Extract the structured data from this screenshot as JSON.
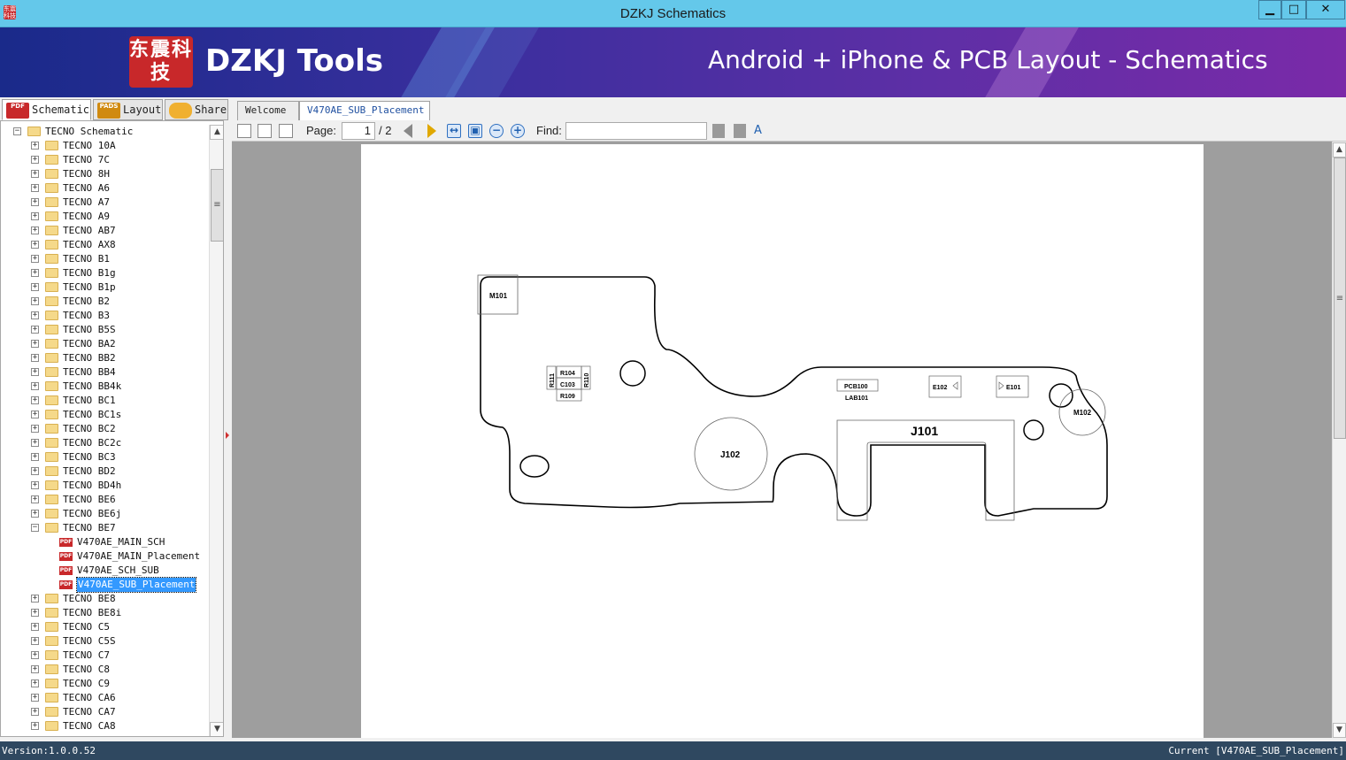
{
  "window": {
    "title": "DZKJ Schematics",
    "app_icon_text": "东震科技",
    "min_glyph": "▁",
    "max_glyph": "□",
    "close_glyph": "✕"
  },
  "banner": {
    "logo_text": "东震科技",
    "brand": "DZKJ Tools",
    "tagline": "Android + iPhone & PCB Layout - Schematics"
  },
  "left_tabs": [
    {
      "label": "Schematic",
      "icon": "pdf-icon",
      "icon_text": "PDF"
    },
    {
      "label": "Layout",
      "icon": "pads-icon",
      "icon_text": "PADS"
    },
    {
      "label": "Share",
      "icon": "share-icon",
      "icon_text": ""
    }
  ],
  "doc_tabs": [
    {
      "label": "Welcome"
    },
    {
      "label": "V470AE_SUB_Placement"
    }
  ],
  "tree": {
    "root": "TECNO Schematic",
    "folders_before": [
      "TECNO 10A",
      "TECNO 7C",
      "TECNO 8H",
      "TECNO A6",
      "TECNO A7",
      "TECNO A9",
      "TECNO AB7",
      "TECNO AX8",
      "TECNO B1",
      "TECNO B1g",
      "TECNO B1p",
      "TECNO B2",
      "TECNO B3",
      "TECNO B5S",
      "TECNO BA2",
      "TECNO BB2",
      "TECNO BB4",
      "TECNO BB4k",
      "TECNO BC1",
      "TECNO BC1s",
      "TECNO BC2",
      "TECNO BC2c",
      "TECNO BC3",
      "TECNO BD2",
      "TECNO BD4h",
      "TECNO BE6",
      "TECNO BE6j"
    ],
    "expanded_folder": "TECNO BE7",
    "files": [
      "V470AE_MAIN_SCH",
      "V470AE_MAIN_Placement",
      "V470AE_SCH_SUB",
      "V470AE_SUB_Placement"
    ],
    "selected_file": "V470AE_SUB_Placement",
    "folders_after": [
      "TECNO BE8",
      "TECNO BE8i",
      "TECNO C5",
      "TECNO C5S",
      "TECNO C7",
      "TECNO C8",
      "TECNO C9",
      "TECNO CA6",
      "TECNO CA7",
      "TECNO CA8"
    ],
    "pdf_icon_text": "PDF"
  },
  "toolbar": {
    "page_label": "Page:",
    "page_value": "1",
    "page_total": "/ 2",
    "find_label": "Find:",
    "find_value": "",
    "zoom_out": "−",
    "zoom_in": "+"
  },
  "pcb": {
    "labels": {
      "m101": "M101",
      "m102": "M102",
      "r111": "R111",
      "r104": "R104",
      "r110": "R110",
      "c103": "C103",
      "r109": "R109",
      "pcb100": "PCB100",
      "lab101": "LAB101",
      "e102": "E102",
      "e101": "E101",
      "j101": "J101",
      "j102": "J102"
    }
  },
  "status": {
    "version": "Version:1.0.0.52",
    "current": "Current [V470AE_SUB_Placement]"
  },
  "colors": {
    "titlebar": "#64c8ea",
    "selection": "#3399ff",
    "statusbar": "#2f4860"
  }
}
